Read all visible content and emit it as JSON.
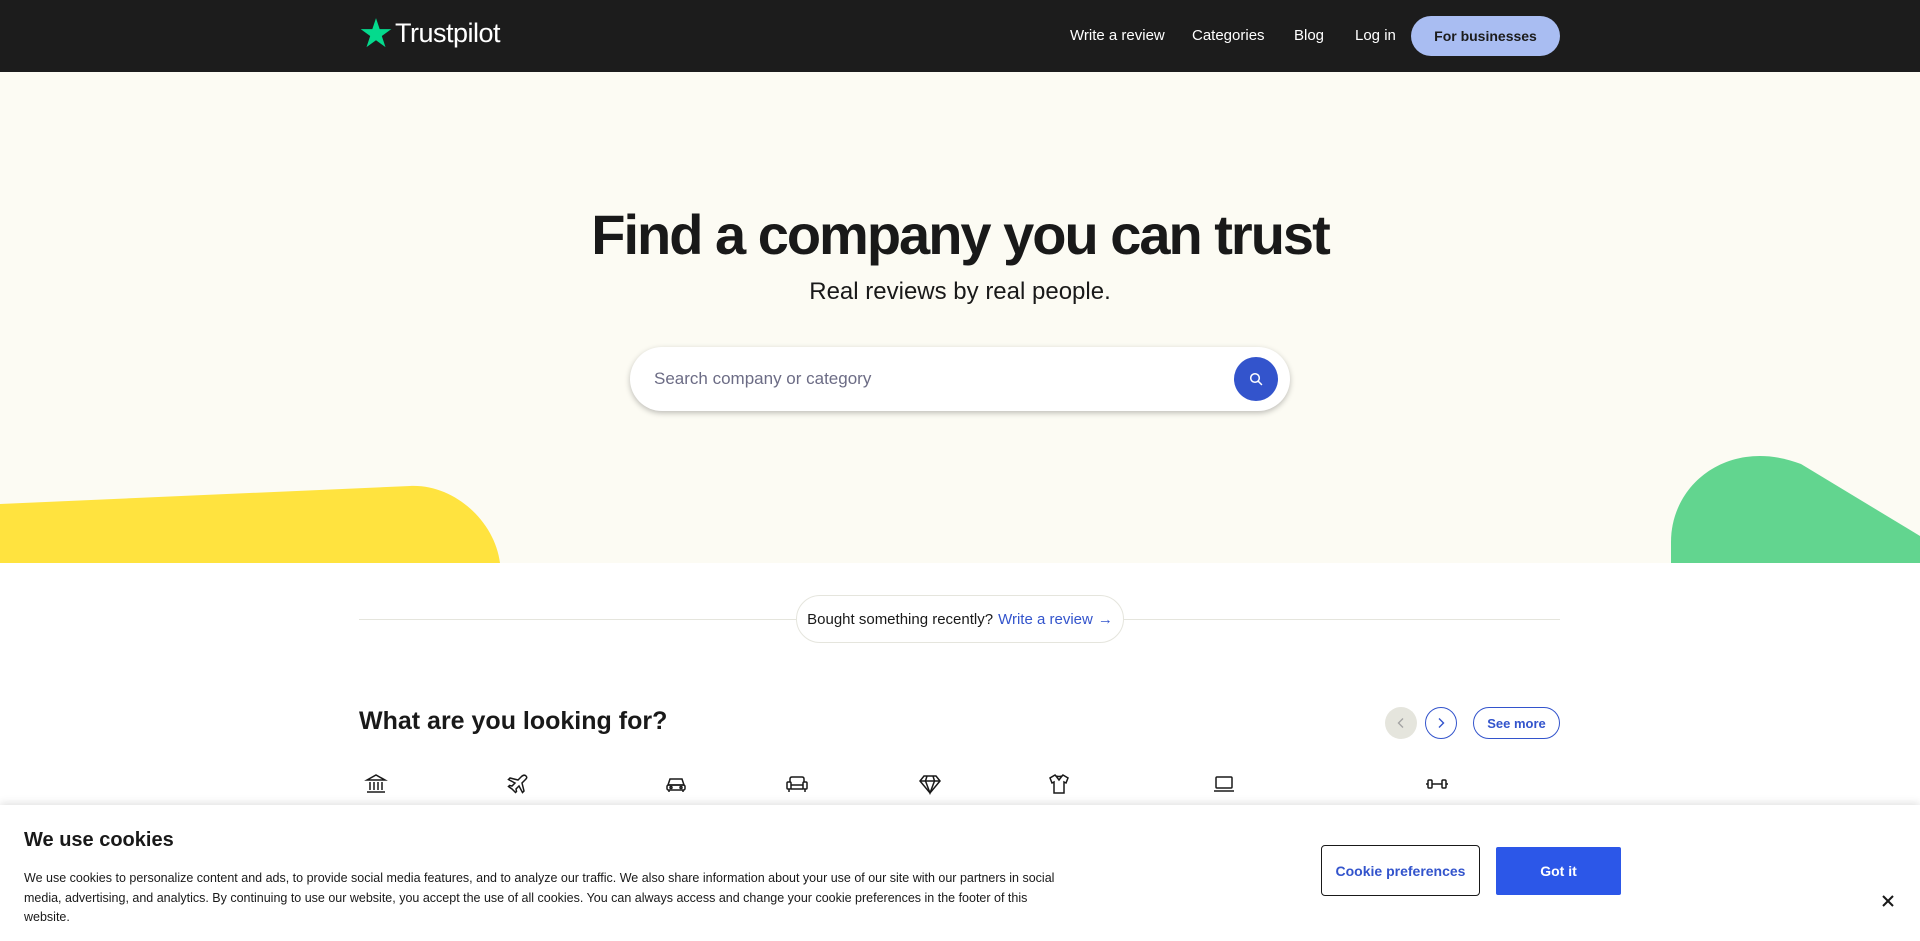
{
  "header": {
    "logo_text": "Trustpilot",
    "nav": {
      "write_review": "Write a review",
      "categories": "Categories",
      "blog": "Blog",
      "login": "Log in",
      "for_businesses": "For businesses"
    }
  },
  "hero": {
    "title": "Find a company you can trust",
    "subtitle": "Real reviews by real people.",
    "search_placeholder": "Search company or category"
  },
  "bought": {
    "text": "Bought something recently?",
    "link": "Write a review",
    "arrow": "→"
  },
  "categories": {
    "title": "What are you looking for?",
    "see_more": "See more",
    "icons": [
      "bank-icon",
      "airplane-icon",
      "car-icon",
      "sofa-icon",
      "diamond-icon",
      "tshirt-icon",
      "laptop-icon",
      "dumbbell-icon"
    ]
  },
  "cookie": {
    "title": "We use cookies",
    "text": "We use cookies to personalize content and ads, to provide social media features, and to analyze our traffic. We also share information about your use of our site with our partners in social media, advertising, and analytics. By continuing to use our website, you accept the use of all cookies. You can always access and change your cookie preferences in the footer of this website.",
    "preferences": "Cookie preferences",
    "accept": "Got it",
    "close": "×"
  },
  "colors": {
    "header_bg": "#1c1c1c",
    "brand_green": "#04da8d",
    "accent_blue": "#3354cc",
    "business_btn": "#a9bdf2",
    "hero_bg": "#fcfbf3",
    "yellow": "#ffe33f",
    "green_shape": "#62d58f"
  }
}
